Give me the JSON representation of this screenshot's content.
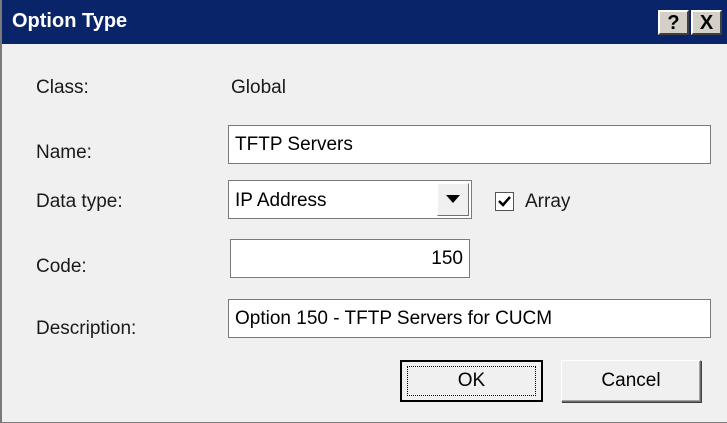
{
  "window": {
    "title": "Option Type",
    "help_glyph": "?",
    "close_glyph": "X"
  },
  "form": {
    "class_label": "Class:",
    "class_value": "Global",
    "name_label": "Name:",
    "name_value": "TFTP Servers",
    "data_type_label": "Data type:",
    "data_type_value": "IP Address",
    "array_label": "Array",
    "array_checked": true,
    "code_label": "Code:",
    "code_value": "150",
    "description_label": "Description:",
    "description_value": "Option 150 - TFTP Servers for CUCM"
  },
  "buttons": {
    "ok": "OK",
    "cancel": "Cancel"
  },
  "colors": {
    "titlebar": "#0a246a",
    "dialog_bg": "#f0f0f0"
  }
}
